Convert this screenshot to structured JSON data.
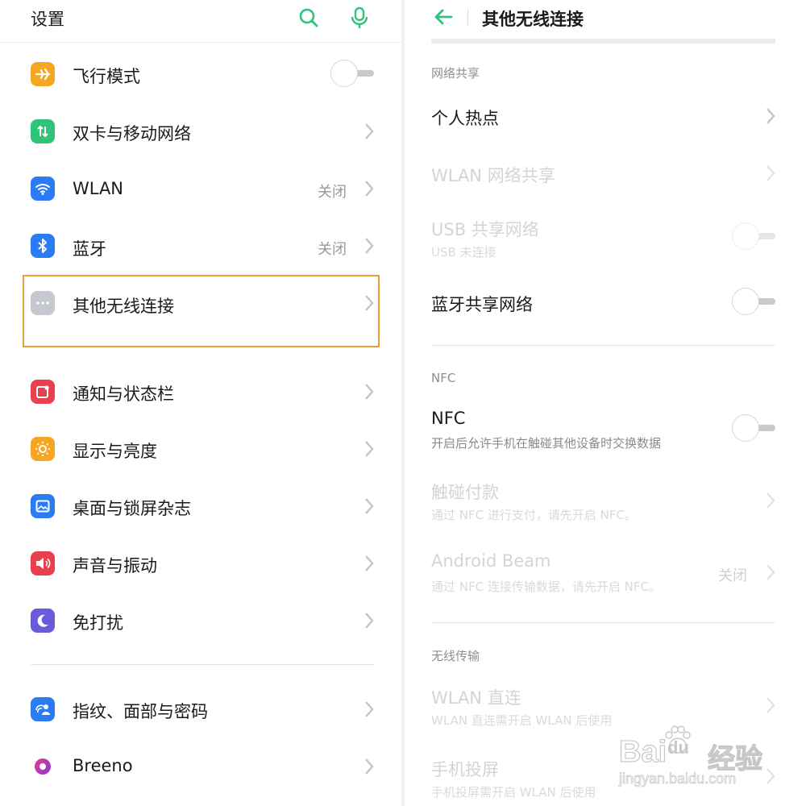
{
  "left": {
    "title": "设置",
    "items": [
      {
        "label": "飞行模式",
        "icon": "airplane-icon",
        "color": "#f5a623",
        "control": "toggle"
      },
      {
        "label": "双卡与移动网络",
        "icon": "sim-data-icon",
        "color": "#2fc47a",
        "control": "chevron"
      },
      {
        "label": "WLAN",
        "icon": "wifi-icon",
        "color": "#2b7bf3",
        "status": "关闭",
        "control": "chevron"
      },
      {
        "label": "蓝牙",
        "icon": "bluetooth-icon",
        "color": "#2b7bf3",
        "status": "关闭",
        "control": "chevron"
      },
      {
        "label": "其他无线连接",
        "icon": "more-dots-icon",
        "color": "#c5c8cf",
        "control": "chevron",
        "highlighted": true
      },
      {
        "label": "通知与状态栏",
        "icon": "notification-icon",
        "color": "#e8404f",
        "control": "chevron"
      },
      {
        "label": "显示与亮度",
        "icon": "brightness-icon",
        "color": "#f5a623",
        "control": "chevron"
      },
      {
        "label": "桌面与锁屏杂志",
        "icon": "wallpaper-icon",
        "color": "#2b7bf3",
        "control": "chevron"
      },
      {
        "label": "声音与振动",
        "icon": "sound-icon",
        "color": "#e8404f",
        "control": "chevron"
      },
      {
        "label": "免打扰",
        "icon": "moon-icon",
        "color": "#6a5bd8",
        "control": "chevron"
      },
      {
        "label": "指纹、面部与密码",
        "icon": "fingerprint-face-icon",
        "color": "#2b7bf3",
        "control": "chevron"
      },
      {
        "label": "Breeno",
        "icon": "breeno-icon",
        "color": "#c03aa0",
        "control": "chevron"
      }
    ]
  },
  "right": {
    "title": "其他无线连接",
    "sections": {
      "tethering": "网络共享",
      "nfc": "NFC",
      "wireless": "无线传输"
    },
    "rows": {
      "hotspot": {
        "label": "个人热点"
      },
      "wlan_share": {
        "label": "WLAN 网络共享"
      },
      "usb_share": {
        "label": "USB 共享网络",
        "sub": "USB 未连接"
      },
      "bt_share": {
        "label": "蓝牙共享网络"
      },
      "nfc": {
        "label": "NFC",
        "sub": "开启后允许手机在触碰其他设备时交换数据"
      },
      "tap_pay": {
        "label": "触碰付款",
        "sub": "通过 NFC 进行支付，请先开启 NFC。"
      },
      "beam": {
        "label": "Android Beam",
        "sub": "通过 NFC 连接传输数据，请先开启 NFC。",
        "status": "关闭"
      },
      "wlan_direct": {
        "label": "WLAN 直连",
        "sub": "WLAN 直连需开启 WLAN 后使用"
      },
      "screencast": {
        "label": "手机投屏",
        "sub": "手机投屏需开启 WLAN 后使用"
      }
    }
  },
  "watermark": {
    "brand": "Bai",
    "brand2": "du",
    "cn": "经验",
    "url": "jingyan.baidu.com"
  },
  "colors": {
    "accent_green": "#2fc47a",
    "highlight": "#e5a23a"
  }
}
